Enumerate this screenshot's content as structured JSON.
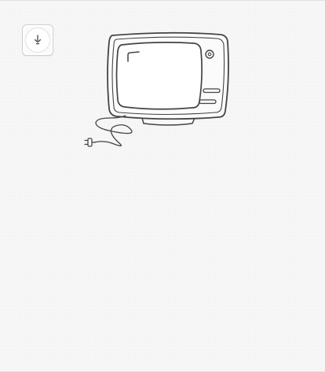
{
  "controls": {
    "power_button": {
      "icon": "power-plug-icon",
      "state": "off"
    }
  },
  "illustration": {
    "subject": "television-icon",
    "cable": "power-cord-icon",
    "plug": "plug-icon"
  },
  "colors": {
    "background": "#f7f7f7",
    "line": "#444444",
    "button_border": "#cfcfcf"
  }
}
